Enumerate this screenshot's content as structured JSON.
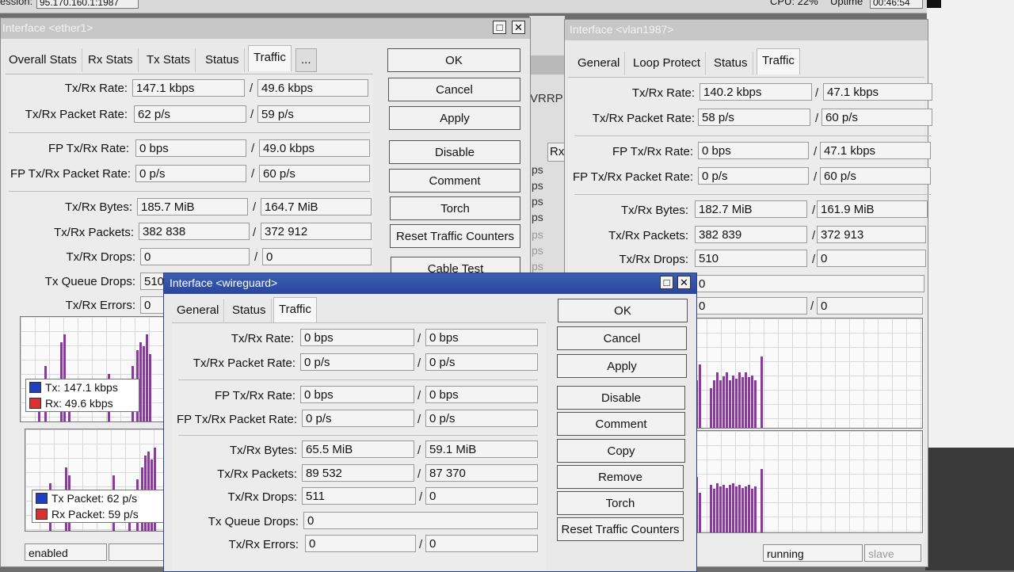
{
  "top": {
    "session_label": "ession:",
    "session_value": "95.170.160.1:1987",
    "cpu": "CPU: 22%",
    "uptime_label": "Uptime",
    "uptime_value": "00:46:54"
  },
  "bg": {
    "vrrp": "VRRP",
    "rx": "Rx",
    "ps": "ps"
  },
  "ether1": {
    "title": "Interface <ether1>",
    "tabs": [
      "Overall Stats",
      "Rx Stats",
      "Tx Stats",
      "Status",
      "Traffic",
      "..."
    ],
    "rows": [
      {
        "label": "Tx/Rx Rate:",
        "tx": "147.1 kbps",
        "rx": "49.6 kbps"
      },
      {
        "label": "Tx/Rx Packet Rate:",
        "tx": "62 p/s",
        "rx": "59 p/s"
      },
      {
        "label": "FP Tx/Rx Rate:",
        "tx": "0 bps",
        "rx": "49.0 kbps"
      },
      {
        "label": "FP Tx/Rx Packet Rate:",
        "tx": "0 p/s",
        "rx": "60 p/s"
      },
      {
        "label": "Tx/Rx Bytes:",
        "tx": "185.7 MiB",
        "rx": "164.7 MiB"
      },
      {
        "label": "Tx/Rx Packets:",
        "tx": "382 838",
        "rx": "372 912"
      },
      {
        "label": "Tx/Rx Drops:",
        "tx": "0",
        "rx": "0"
      },
      {
        "label": "Tx Queue Drops:",
        "tx": "510"
      },
      {
        "label": "Tx/Rx Errors:",
        "tx": "0"
      }
    ],
    "buttons": [
      "OK",
      "Cancel",
      "Apply",
      "Disable",
      "Comment",
      "Torch",
      "Reset Traffic Counters",
      "Cable Test"
    ],
    "legend1": {
      "tx": "Tx:  147.1 kbps",
      "rx": "Rx:  49.6 kbps"
    },
    "legend2": {
      "tx": "Tx Packet:  62 p/s",
      "rx": "Rx Packet:  59 p/s"
    },
    "status": "enabled",
    "colors": {
      "tx": "#1f3fbf",
      "rx": "#d93030"
    }
  },
  "vlan": {
    "title": "Interface <vlan1987>",
    "tabs": [
      "General",
      "Loop Protect",
      "Status",
      "Traffic"
    ],
    "rows": [
      {
        "label": "Tx/Rx Rate:",
        "tx": "140.2 kbps",
        "rx": "47.1 kbps"
      },
      {
        "label": "Tx/Rx Packet Rate:",
        "tx": "58 p/s",
        "rx": "60 p/s"
      },
      {
        "label": "FP Tx/Rx Rate:",
        "tx": "0 bps",
        "rx": "47.1 kbps"
      },
      {
        "label": "FP Tx/Rx Packet Rate:",
        "tx": "0 p/s",
        "rx": "60 p/s"
      },
      {
        "label": "Tx/Rx Bytes:",
        "tx": "182.7 MiB",
        "rx": "161.9 MiB"
      },
      {
        "label": "Tx/Rx Packets:",
        "tx": "382 839",
        "rx": "372 913"
      },
      {
        "label": "Tx/Rx Drops:",
        "tx": "510",
        "rx": "0"
      }
    ],
    "extra": {
      "queue": "0",
      "err_tx": "0",
      "err_rx": "0"
    },
    "status_running": "running",
    "status_slave": "slave"
  },
  "wg": {
    "title": "Interface <wireguard>",
    "tabs": [
      "General",
      "Status",
      "Traffic"
    ],
    "rows": [
      {
        "label": "Tx/Rx Rate:",
        "tx": "0 bps",
        "rx": "0 bps"
      },
      {
        "label": "Tx/Rx Packet Rate:",
        "tx": "0 p/s",
        "rx": "0 p/s"
      },
      {
        "label": "FP Tx/Rx Rate:",
        "tx": "0 bps",
        "rx": "0 bps"
      },
      {
        "label": "FP Tx/Rx Packet Rate:",
        "tx": "0 p/s",
        "rx": "0 p/s"
      },
      {
        "label": "Tx/Rx Bytes:",
        "tx": "65.5 MiB",
        "rx": "59.1 MiB"
      },
      {
        "label": "Tx/Rx Packets:",
        "tx": "89 532",
        "rx": "87 370"
      },
      {
        "label": "Tx/Rx Drops:",
        "tx": "511",
        "rx": "0"
      },
      {
        "label": "Tx Queue Drops:",
        "tx": "0"
      },
      {
        "label": "Tx/Rx Errors:",
        "tx": "0",
        "rx": "0"
      }
    ],
    "buttons": [
      "OK",
      "Cancel",
      "Apply",
      "Disable",
      "Comment",
      "Copy",
      "Remove",
      "Torch",
      "Reset Traffic Counters"
    ]
  }
}
